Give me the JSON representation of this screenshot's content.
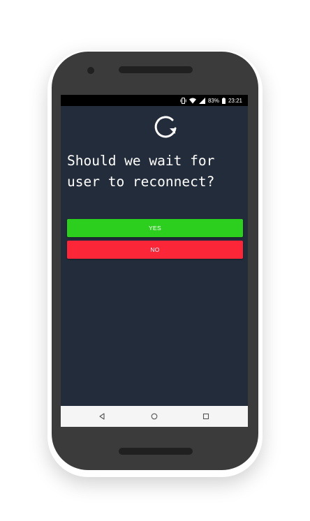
{
  "status_bar": {
    "battery_percent": "83%",
    "time": "23:21",
    "icons": [
      "vibrate-icon",
      "wifi-icon",
      "signal-icon",
      "battery-icon"
    ]
  },
  "app": {
    "logo_icon": "refresh-arrow-icon",
    "question": "Should we wait for user to reconnect?",
    "yes_label": "YES",
    "no_label": "NO"
  },
  "nav_bar": {
    "icons": [
      "back-icon",
      "home-icon",
      "recents-icon"
    ]
  },
  "colors": {
    "screen_background": "#222c3a",
    "yes_button": "#2dcf1f",
    "no_button": "#fb2637",
    "phone_body": "#3b3b3b"
  }
}
